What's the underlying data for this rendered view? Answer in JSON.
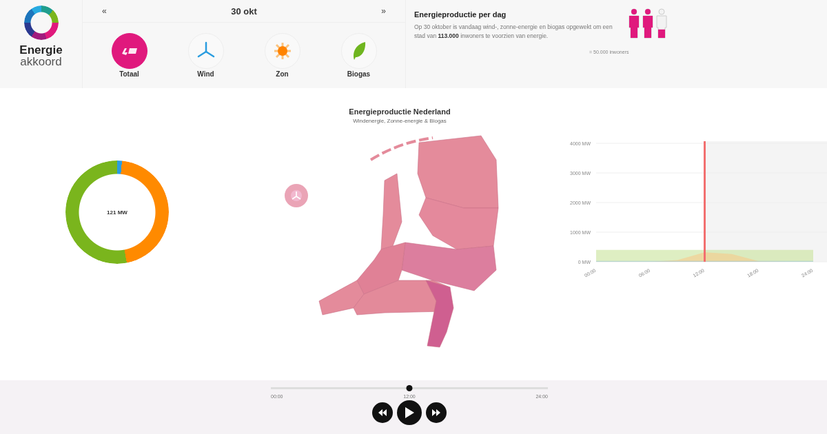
{
  "logo": {
    "line_1": "Energie",
    "line_2": "akkoord"
  },
  "date_bar": {
    "prev": "«",
    "date": "30 okt",
    "next": "»"
  },
  "sources": [
    {
      "kind": "total",
      "label": "Totaal",
      "selected": true
    },
    {
      "kind": "wind",
      "label": "Wind",
      "selected": false
    },
    {
      "kind": "sun",
      "label": "Zon",
      "selected": false
    },
    {
      "kind": "leaf",
      "label": "Biogas",
      "selected": false
    }
  ],
  "info": {
    "title": "Energieproductie per dag",
    "text": "Op 30 oktober is vandaag wind-, zonne-energie en biogas opgewekt om een stad van **113.000** inwoners te voorzien van energie.",
    "legend": "= 50.000 inwoners"
  },
  "donut": {
    "center": "121 MW"
  },
  "map": {
    "title": "Energieproductie Nederland",
    "subtitle": "Windenergie, Zonne-energie & Biogas"
  },
  "chart": {
    "chart_data": {
      "type": "area",
      "stacked": false,
      "grid": true,
      "ref_lines": [
        {
          "axis": "x",
          "value": 12,
          "color": "#f26f6f"
        }
      ],
      "x": [
        0,
        3,
        6,
        9,
        12,
        15,
        18,
        21,
        24
      ],
      "series": [
        {
          "color": "#c8e29a",
          "values": [
            400,
            400,
            400,
            400,
            400,
            400,
            400,
            400,
            400
          ]
        },
        {
          "color": "#f7c98a",
          "values": [
            0,
            0,
            0,
            60,
            320,
            260,
            20,
            0,
            0
          ]
        },
        {
          "color": "#9fc7d8",
          "values": [
            30,
            30,
            30,
            30,
            30,
            30,
            30,
            30,
            30
          ]
        }
      ],
      "ylim": [
        0,
        4000
      ],
      "xlim": [
        0,
        24
      ],
      "yticks": [
        {
          "value": 0,
          "label": "0 MW"
        },
        {
          "value": 1000,
          "label": "1000 MW"
        },
        {
          "value": 2000,
          "label": "2000 MW"
        },
        {
          "value": 3000,
          "label": "3000 MW"
        },
        {
          "value": 4000,
          "label": "4000 MW"
        }
      ],
      "xticks": [
        {
          "value": 0,
          "label": "00:00"
        },
        {
          "value": 6,
          "label": "06:00"
        },
        {
          "value": 12,
          "label": "12:00"
        },
        {
          "value": 18,
          "label": "18:00"
        },
        {
          "value": 24,
          "label": "24:00"
        }
      ]
    }
  },
  "timeline": {
    "level": 0.5,
    "start": "00:00",
    "current": "12:00",
    "end": "24:00"
  }
}
